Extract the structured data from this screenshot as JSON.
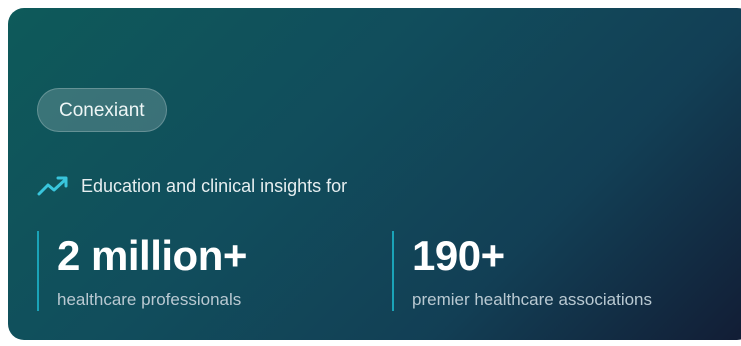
{
  "brand": {
    "name": "Conexiant"
  },
  "insight": {
    "text": "Education and clinical insights for",
    "icon": "trending-up-icon"
  },
  "stats": [
    {
      "value": "2 million+",
      "label": "healthcare professionals"
    },
    {
      "value": "190+",
      "label": "premier healthcare associations"
    }
  ],
  "colors": {
    "accent": "#1aa3b8",
    "icon": "#39c5dc",
    "gradient_start": "#0e5a5a",
    "gradient_end": "#121c34"
  }
}
